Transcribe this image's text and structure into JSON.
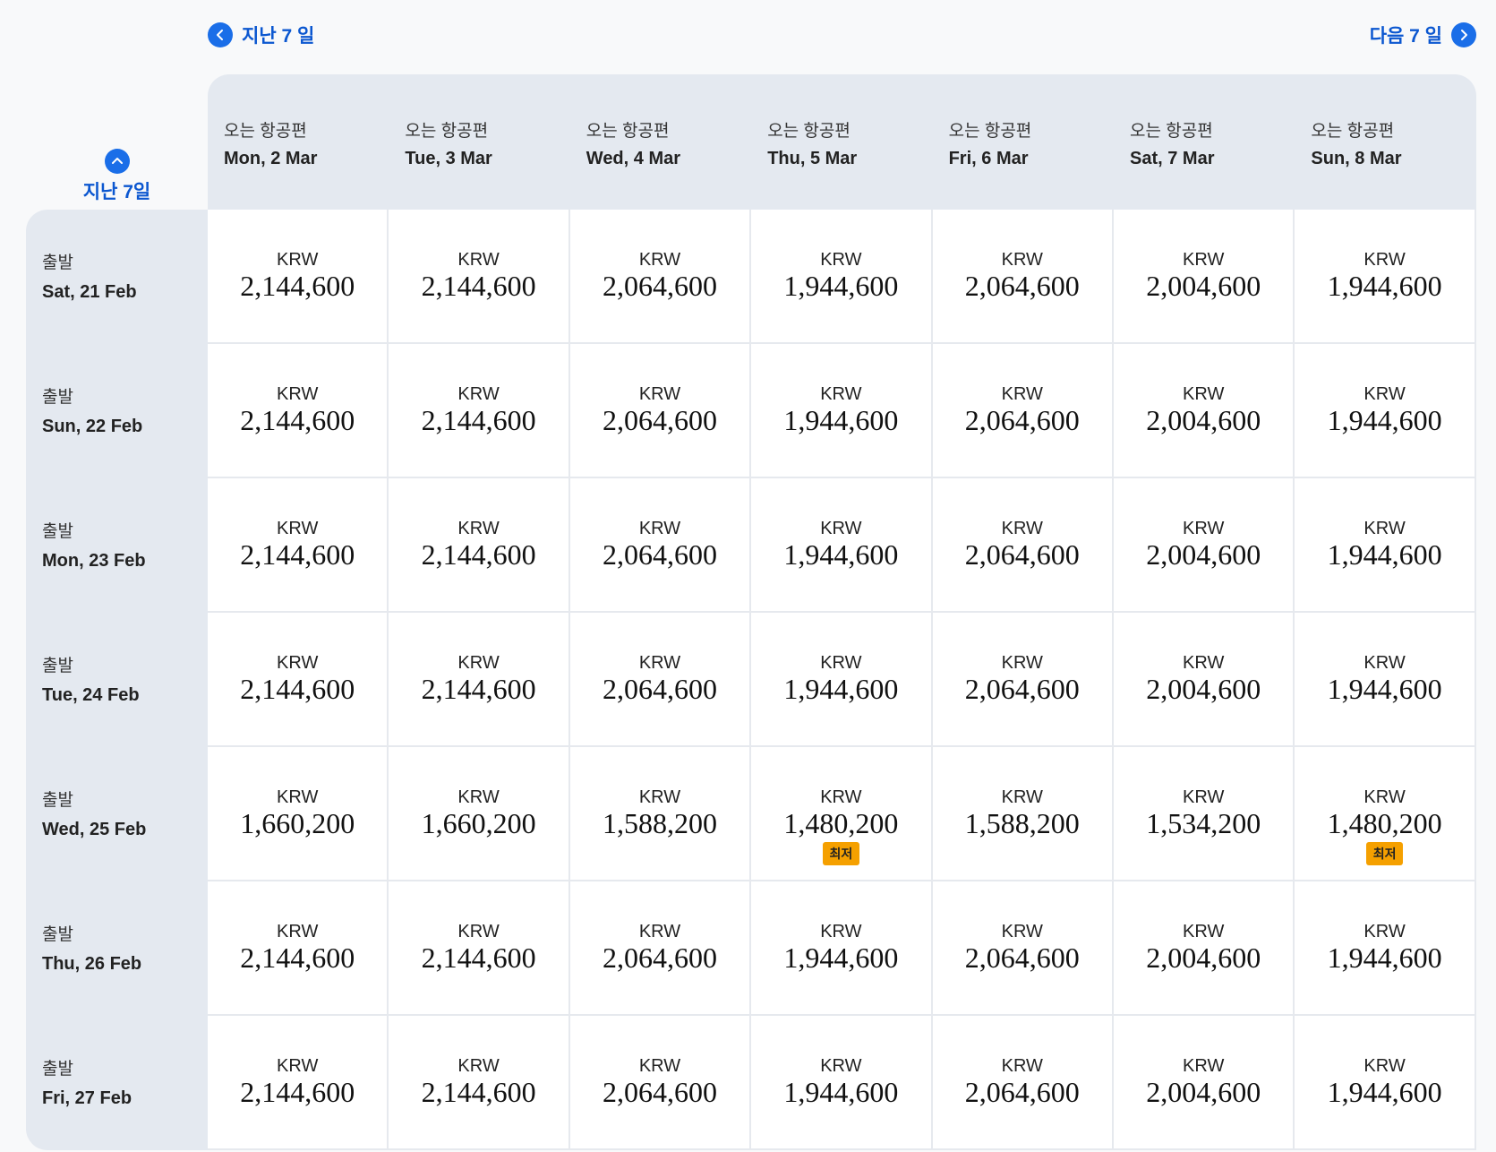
{
  "nav": {
    "prev_label": "지난 7 일",
    "next_label": "다음 7 일",
    "prev_week_vertical_label": "지난 7일"
  },
  "columns": [
    {
      "sub": "오는 항공편",
      "date": "Mon, 2 Mar"
    },
    {
      "sub": "오는 항공편",
      "date": "Tue, 3 Mar"
    },
    {
      "sub": "오는 항공편",
      "date": "Wed, 4 Mar"
    },
    {
      "sub": "오는 항공편",
      "date": "Thu, 5 Mar"
    },
    {
      "sub": "오는 항공편",
      "date": "Fri, 6 Mar"
    },
    {
      "sub": "오는 항공편",
      "date": "Sat, 7 Mar"
    },
    {
      "sub": "오는 항공편",
      "date": "Sun, 8 Mar"
    }
  ],
  "rows": [
    {
      "sub": "출발",
      "date": "Sat, 21 Feb",
      "cells": [
        {
          "currency": "KRW",
          "price": "2,144,600"
        },
        {
          "currency": "KRW",
          "price": "2,144,600"
        },
        {
          "currency": "KRW",
          "price": "2,064,600"
        },
        {
          "currency": "KRW",
          "price": "1,944,600"
        },
        {
          "currency": "KRW",
          "price": "2,064,600"
        },
        {
          "currency": "KRW",
          "price": "2,004,600"
        },
        {
          "currency": "KRW",
          "price": "1,944,600"
        }
      ]
    },
    {
      "sub": "출발",
      "date": "Sun, 22 Feb",
      "cells": [
        {
          "currency": "KRW",
          "price": "2,144,600"
        },
        {
          "currency": "KRW",
          "price": "2,144,600"
        },
        {
          "currency": "KRW",
          "price": "2,064,600"
        },
        {
          "currency": "KRW",
          "price": "1,944,600"
        },
        {
          "currency": "KRW",
          "price": "2,064,600"
        },
        {
          "currency": "KRW",
          "price": "2,004,600"
        },
        {
          "currency": "KRW",
          "price": "1,944,600"
        }
      ]
    },
    {
      "sub": "출발",
      "date": "Mon, 23 Feb",
      "cells": [
        {
          "currency": "KRW",
          "price": "2,144,600"
        },
        {
          "currency": "KRW",
          "price": "2,144,600"
        },
        {
          "currency": "KRW",
          "price": "2,064,600"
        },
        {
          "currency": "KRW",
          "price": "1,944,600"
        },
        {
          "currency": "KRW",
          "price": "2,064,600"
        },
        {
          "currency": "KRW",
          "price": "2,004,600"
        },
        {
          "currency": "KRW",
          "price": "1,944,600"
        }
      ]
    },
    {
      "sub": "출발",
      "date": "Tue, 24 Feb",
      "cells": [
        {
          "currency": "KRW",
          "price": "2,144,600"
        },
        {
          "currency": "KRW",
          "price": "2,144,600"
        },
        {
          "currency": "KRW",
          "price": "2,064,600"
        },
        {
          "currency": "KRW",
          "price": "1,944,600"
        },
        {
          "currency": "KRW",
          "price": "2,064,600"
        },
        {
          "currency": "KRW",
          "price": "2,004,600"
        },
        {
          "currency": "KRW",
          "price": "1,944,600"
        }
      ]
    },
    {
      "sub": "출발",
      "date": "Wed, 25 Feb",
      "cells": [
        {
          "currency": "KRW",
          "price": "1,660,200"
        },
        {
          "currency": "KRW",
          "price": "1,660,200"
        },
        {
          "currency": "KRW",
          "price": "1,588,200"
        },
        {
          "currency": "KRW",
          "price": "1,480,200",
          "badge": "최저"
        },
        {
          "currency": "KRW",
          "price": "1,588,200"
        },
        {
          "currency": "KRW",
          "price": "1,534,200"
        },
        {
          "currency": "KRW",
          "price": "1,480,200",
          "badge": "최저"
        }
      ]
    },
    {
      "sub": "출발",
      "date": "Thu, 26 Feb",
      "cells": [
        {
          "currency": "KRW",
          "price": "2,144,600"
        },
        {
          "currency": "KRW",
          "price": "2,144,600"
        },
        {
          "currency": "KRW",
          "price": "2,064,600"
        },
        {
          "currency": "KRW",
          "price": "1,944,600"
        },
        {
          "currency": "KRW",
          "price": "2,064,600"
        },
        {
          "currency": "KRW",
          "price": "2,004,600"
        },
        {
          "currency": "KRW",
          "price": "1,944,600"
        }
      ]
    },
    {
      "sub": "출발",
      "date": "Fri, 27 Feb",
      "cells": [
        {
          "currency": "KRW",
          "price": "2,144,600"
        },
        {
          "currency": "KRW",
          "price": "2,144,600"
        },
        {
          "currency": "KRW",
          "price": "2,064,600"
        },
        {
          "currency": "KRW",
          "price": "1,944,600"
        },
        {
          "currency": "KRW",
          "price": "2,064,600"
        },
        {
          "currency": "KRW",
          "price": "2,004,600"
        },
        {
          "currency": "KRW",
          "price": "1,944,600"
        }
      ]
    }
  ],
  "colors": {
    "accent": "#1a6ee8",
    "link_text": "#0b57d0",
    "header_bg": "#e4e9f0",
    "lowest_badge": "#f5a000"
  },
  "icons": {
    "prev": "chevron-left-icon",
    "next": "chevron-right-icon",
    "up": "chevron-up-icon"
  }
}
